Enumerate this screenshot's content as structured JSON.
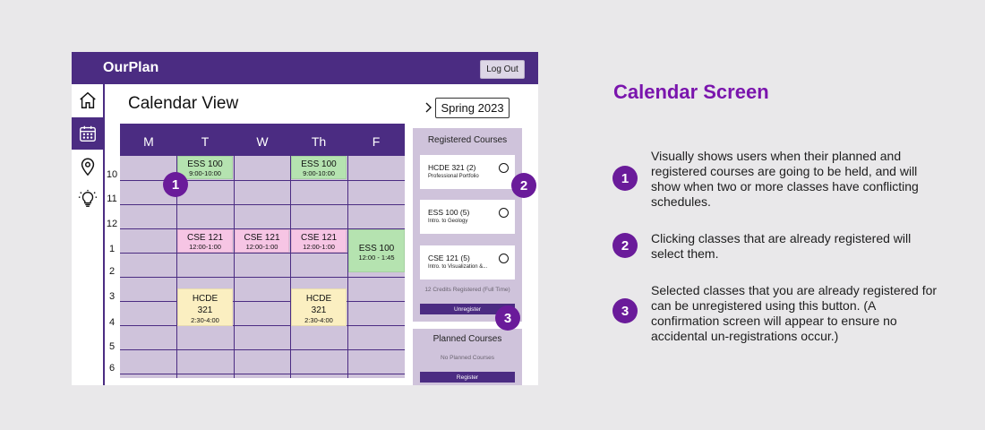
{
  "app": {
    "brand": "OurPlan",
    "logout_label": "Log Out",
    "nav": [
      {
        "icon": "home-icon"
      },
      {
        "icon": "calendar-icon",
        "active": true
      },
      {
        "icon": "map-pin-icon"
      },
      {
        "icon": "lightbulb-icon"
      }
    ],
    "page_title": "Calendar View",
    "semester": "Spring 2023",
    "accent_color": "#4b2c82",
    "calendar": {
      "days": [
        "M",
        "T",
        "W",
        "Th",
        "F"
      ],
      "hours": [
        "10",
        "11",
        "12",
        "1",
        "2",
        "3",
        "4",
        "5",
        "6"
      ],
      "events": [
        {
          "name": "ESS 100",
          "time": "9:00-10:00",
          "day": "T",
          "color": "green"
        },
        {
          "name": "ESS 100",
          "time": "9:00-10:00",
          "day": "Th",
          "color": "green"
        },
        {
          "name": "CSE 121",
          "time": "12:00-1:00",
          "day": "T",
          "color": "pink"
        },
        {
          "name": "CSE 121",
          "time": "12:00-1:00",
          "day": "W",
          "color": "pink"
        },
        {
          "name": "CSE 121",
          "time": "12:00-1:00",
          "day": "Th",
          "color": "pink"
        },
        {
          "name": "ESS 100",
          "time": "12:00 - 1:45",
          "day": "F",
          "color": "green"
        },
        {
          "name": "HCDE 321",
          "time": "2:30-4:00",
          "day": "T",
          "color": "yellow"
        },
        {
          "name": "HCDE 321",
          "time": "2:30-4:00",
          "day": "Th",
          "color": "yellow"
        }
      ]
    },
    "registered": {
      "title": "Registered Courses",
      "courses": [
        {
          "name": "HCDE 321 (2)",
          "subtitle": "Professional Portfolio"
        },
        {
          "name": "ESS 100 (5)",
          "subtitle": "Intro. to Geology"
        },
        {
          "name": "CSE 121 (5)",
          "subtitle": "Intro. to Visualization &..."
        }
      ],
      "credits": "12 Credits Registered (Full Time)",
      "unregister_label": "Unregister"
    },
    "planned": {
      "title": "Planned Courses",
      "empty": "No Planned Courses",
      "register_label": "Register"
    }
  },
  "badges": [
    "1",
    "2",
    "3"
  ],
  "badge_color": "#6a1b9a",
  "screen_title": "Calendar Screen",
  "descriptions": [
    {
      "number": "1",
      "text": "Visually shows users when their planned and registered courses are going to be held, and will show when two or more classes have conflicting schedules."
    },
    {
      "number": "2",
      "text": "Clicking classes that are already registered will select them."
    },
    {
      "number": "3",
      "text": "Selected classes that you are already registered for can be unregistered using this button. (A confirmation screen will appear to ensure no accidental un-registrations occur.)"
    }
  ]
}
